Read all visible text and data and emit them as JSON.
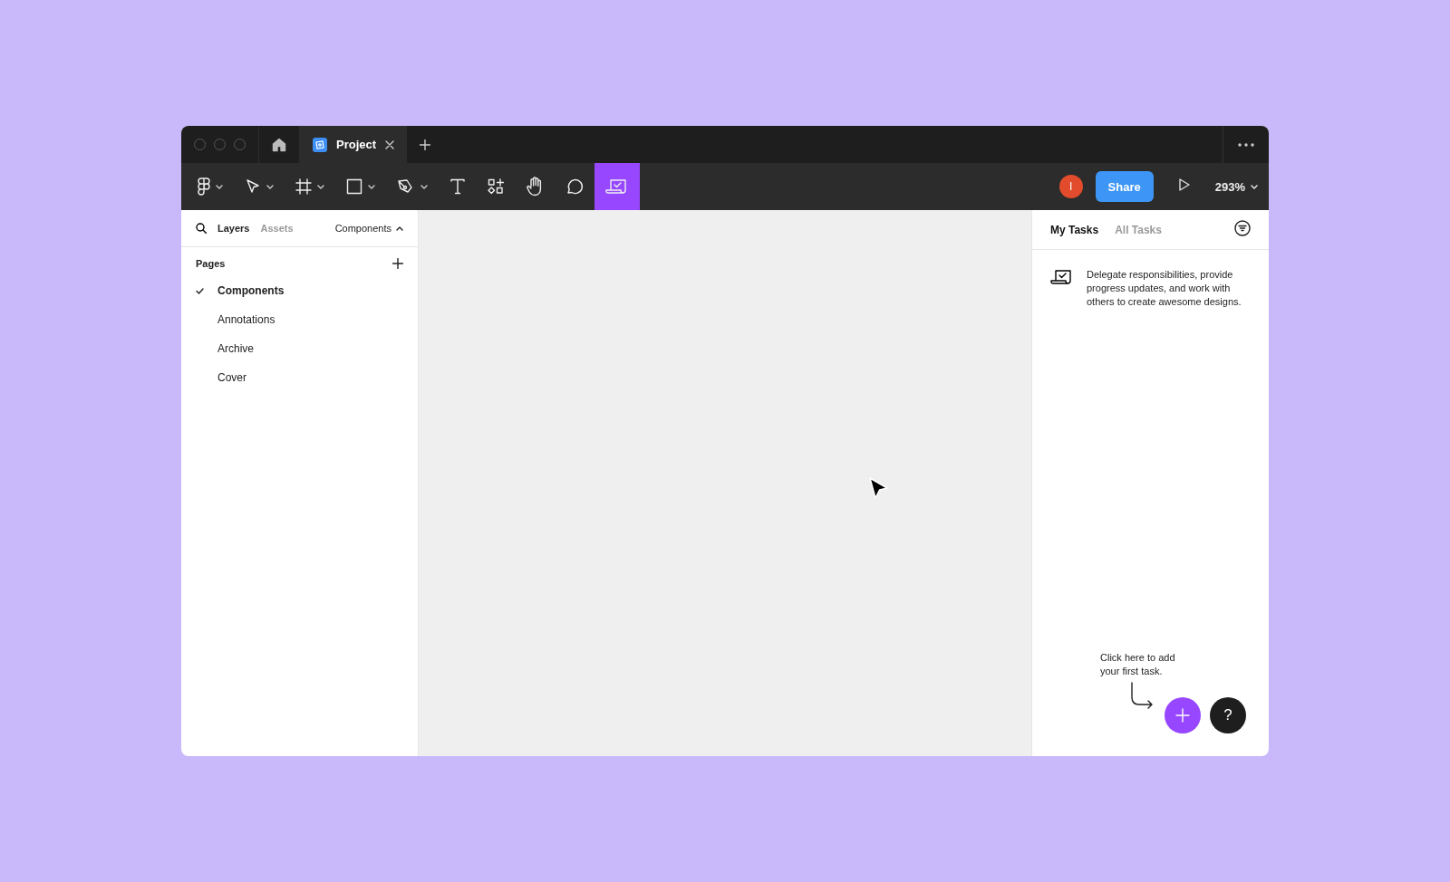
{
  "titlebar": {
    "tabs": [
      {
        "label": "Project",
        "selected": true
      }
    ]
  },
  "toolbar": {
    "tools": [
      {
        "kind": "logo",
        "dropdown": true,
        "selected": false
      },
      {
        "kind": "move",
        "dropdown": true,
        "selected": false
      },
      {
        "kind": "frame",
        "dropdown": true,
        "selected": false
      },
      {
        "kind": "shape",
        "dropdown": true,
        "selected": false
      },
      {
        "kind": "pen",
        "dropdown": true,
        "selected": false
      },
      {
        "kind": "text",
        "dropdown": false,
        "selected": false
      },
      {
        "kind": "resources",
        "dropdown": false,
        "selected": false
      },
      {
        "kind": "hand",
        "dropdown": false,
        "selected": false
      },
      {
        "kind": "comment",
        "dropdown": false,
        "selected": false
      },
      {
        "kind": "tasks",
        "dropdown": false,
        "selected": true
      }
    ],
    "avatar": {
      "initial": "I",
      "color": "#e24c2c"
    },
    "share": "Share",
    "zoom": "293%"
  },
  "left_panel": {
    "tabs": [
      {
        "label": "Layers",
        "selected": true
      },
      {
        "label": "Assets",
        "selected": false
      }
    ],
    "page_menu": "Components",
    "pages_title": "Pages",
    "pages": [
      {
        "label": "Components",
        "selected": true
      },
      {
        "label": "Annotations",
        "selected": false
      },
      {
        "label": "Archive",
        "selected": false
      },
      {
        "label": "Cover",
        "selected": false
      }
    ]
  },
  "right_panel": {
    "tabs": [
      {
        "label": "My Tasks",
        "selected": true
      },
      {
        "label": "All Tasks",
        "selected": false
      }
    ],
    "message": "Delegate responsibilities, provide progress updates, and work with others to create awesome designs.",
    "hint": "Click here to add your first task.",
    "help": "?"
  }
}
